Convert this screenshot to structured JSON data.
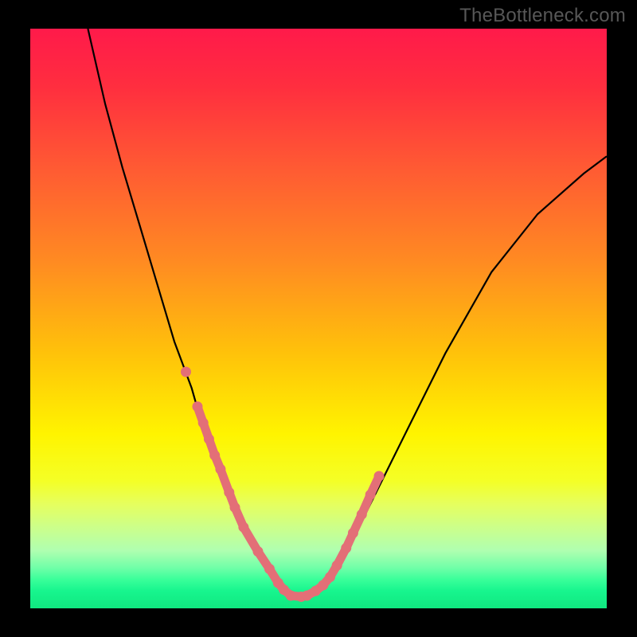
{
  "attribution": "TheBottleneck.com",
  "colors": {
    "background": "#000000",
    "gradient_top": "#ff1a4a",
    "gradient_bottom": "#10e880",
    "curve": "#000000",
    "dots": "#e36f77"
  },
  "chart_data": {
    "type": "line",
    "title": "",
    "xlabel": "",
    "ylabel": "",
    "xlim": [
      0,
      1
    ],
    "ylim": [
      0,
      1
    ],
    "series": [
      {
        "name": "curve",
        "x": [
          0.1,
          0.13,
          0.16,
          0.19,
          0.22,
          0.25,
          0.28,
          0.3,
          0.32,
          0.34,
          0.36,
          0.38,
          0.4,
          0.42,
          0.44,
          0.46,
          0.49,
          0.52,
          0.56,
          0.6,
          0.66,
          0.72,
          0.8,
          0.88,
          0.96,
          1.0
        ],
        "y": [
          1.0,
          0.87,
          0.76,
          0.66,
          0.56,
          0.46,
          0.38,
          0.31,
          0.26,
          0.21,
          0.17,
          0.13,
          0.09,
          0.06,
          0.035,
          0.02,
          0.028,
          0.055,
          0.12,
          0.2,
          0.32,
          0.44,
          0.58,
          0.68,
          0.75,
          0.78
        ]
      },
      {
        "name": "markers",
        "x": [
          0.27,
          0.29,
          0.3,
          0.31,
          0.32,
          0.33,
          0.345,
          0.355,
          0.37,
          0.395,
          0.415,
          0.43,
          0.44,
          0.452,
          0.47,
          0.48,
          0.495,
          0.508,
          0.52,
          0.532,
          0.548,
          0.56,
          0.575,
          0.59,
          0.605
        ],
        "y": [
          0.408,
          0.348,
          0.32,
          0.292,
          0.264,
          0.24,
          0.2,
          0.174,
          0.14,
          0.098,
          0.068,
          0.044,
          0.032,
          0.022,
          0.02,
          0.022,
          0.03,
          0.04,
          0.054,
          0.074,
          0.104,
          0.13,
          0.162,
          0.196,
          0.228
        ]
      }
    ]
  }
}
